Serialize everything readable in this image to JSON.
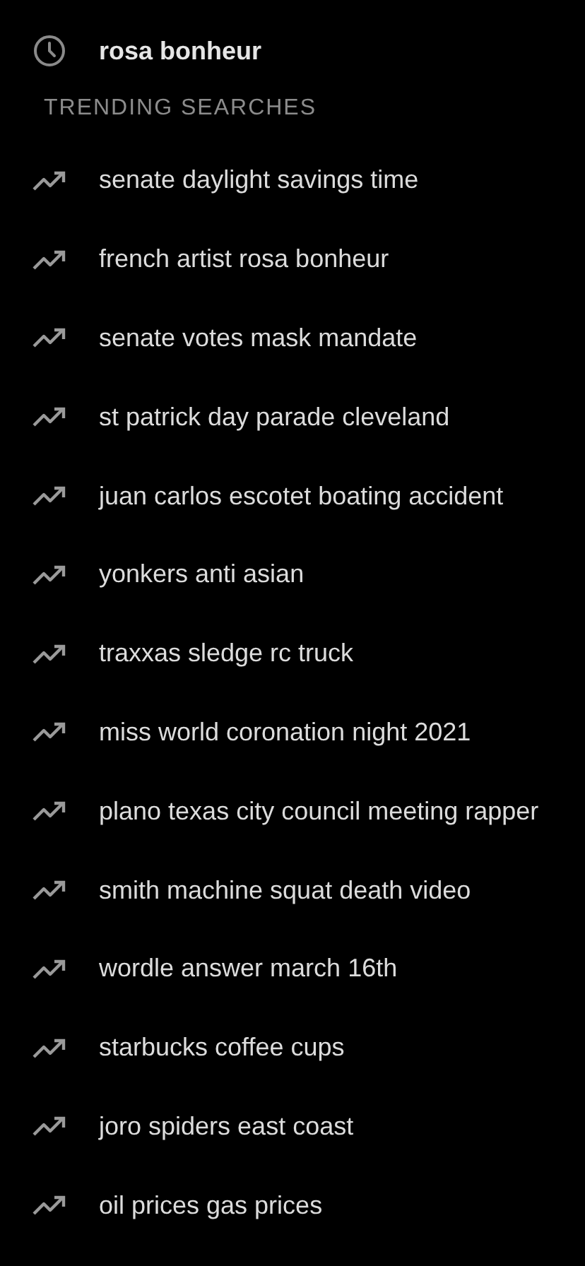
{
  "recent": [
    {
      "text": "rosa bonheur"
    }
  ],
  "trending": {
    "heading": "TRENDING SEARCHES",
    "items": [
      {
        "text": "senate daylight savings time"
      },
      {
        "text": "french artist rosa bonheur"
      },
      {
        "text": "senate votes mask mandate"
      },
      {
        "text": "st patrick day parade cleveland"
      },
      {
        "text": "juan carlos escotet boating accident"
      },
      {
        "text": "yonkers anti asian"
      },
      {
        "text": "traxxas sledge rc truck"
      },
      {
        "text": "miss world coronation night 2021"
      },
      {
        "text": "plano texas city council meeting rapper"
      },
      {
        "text": "smith machine squat death video"
      },
      {
        "text": "wordle answer march 16th"
      },
      {
        "text": "starbucks coffee cups"
      },
      {
        "text": "joro spiders east coast"
      },
      {
        "text": "oil prices gas prices"
      }
    ]
  }
}
